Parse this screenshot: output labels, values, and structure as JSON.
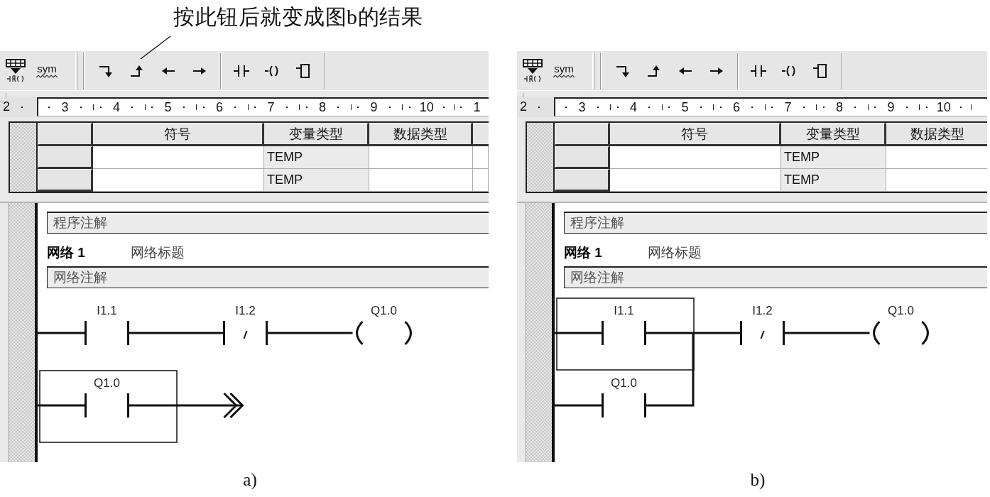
{
  "annotation": {
    "text": "按此钮后就变成图b的结果"
  },
  "panels": [
    {
      "caption": "a)",
      "toolbar": [
        {
          "kind": "network"
        },
        {
          "kind": "symbol",
          "label": "sym"
        },
        {
          "kind": "grip"
        },
        {
          "kind": "branch_down"
        },
        {
          "kind": "branch_up"
        },
        {
          "kind": "line_left"
        },
        {
          "kind": "line_right"
        },
        {
          "kind": "separator"
        },
        {
          "kind": "contact"
        },
        {
          "kind": "coil"
        },
        {
          "kind": "box"
        },
        {
          "kind": "separator"
        }
      ],
      "ruler": {
        "start": "2",
        "marks": [
          "3",
          "4",
          "5",
          "6",
          "7",
          "8",
          "9",
          "10",
          "1"
        ]
      },
      "variable_table": {
        "columns": [
          "符号",
          "变量类型",
          "数据类型"
        ],
        "rows": [
          {
            "var_type": "TEMP"
          },
          {
            "var_type": "TEMP"
          }
        ]
      },
      "program_comment": "程序注解",
      "network": {
        "number": "网络 1",
        "title": "网络标题",
        "comment": "网络注解",
        "rows": [
          {
            "kind": "rung",
            "elements": [
              {
                "kind": "contact",
                "address": "I1.1",
                "selected": false
              },
              {
                "kind": "nc_contact",
                "address": "I1.2",
                "selected": false
              },
              {
                "kind": "coil",
                "address": "Q1.0",
                "selected": false
              }
            ]
          },
          {
            "kind": "branch",
            "closed": false,
            "elements": [
              {
                "kind": "contact",
                "address": "Q1.0",
                "selected": true
              }
            ]
          }
        ]
      }
    },
    {
      "caption": "b)",
      "toolbar": [
        {
          "kind": "network"
        },
        {
          "kind": "symbol",
          "label": "sym"
        },
        {
          "kind": "grip"
        },
        {
          "kind": "branch_down"
        },
        {
          "kind": "branch_up"
        },
        {
          "kind": "line_left"
        },
        {
          "kind": "line_right"
        },
        {
          "kind": "separator"
        },
        {
          "kind": "contact"
        },
        {
          "kind": "coil"
        },
        {
          "kind": "box"
        },
        {
          "kind": "separator"
        }
      ],
      "ruler": {
        "start": "2",
        "marks": [
          "3",
          "4",
          "5",
          "6",
          "7",
          "8",
          "9",
          "10"
        ]
      },
      "variable_table": {
        "columns": [
          "符号",
          "变量类型",
          "数据类型"
        ],
        "rows": [
          {
            "var_type": "TEMP"
          },
          {
            "var_type": "TEMP"
          }
        ]
      },
      "program_comment": "程序注解",
      "network": {
        "number": "网络 1",
        "title": "网络标题",
        "comment": "网络注解",
        "rows": [
          {
            "kind": "rung",
            "elements": [
              {
                "kind": "contact",
                "address": "I1.1",
                "selected": true
              },
              {
                "kind": "nc_contact",
                "address": "I1.2",
                "selected": false
              },
              {
                "kind": "coil",
                "address": "Q1.0",
                "selected": false
              }
            ]
          },
          {
            "kind": "branch",
            "closed": true,
            "elements": [
              {
                "kind": "contact",
                "address": "Q1.0",
                "selected": false
              }
            ]
          }
        ]
      }
    }
  ]
}
